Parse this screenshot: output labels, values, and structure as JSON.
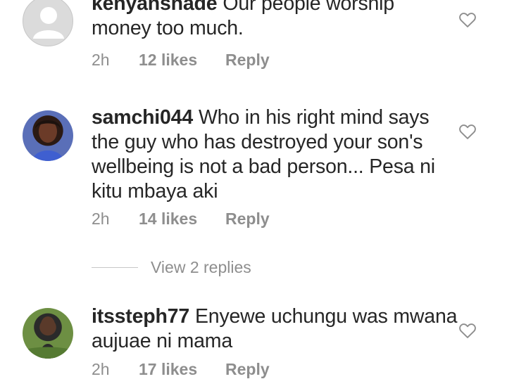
{
  "comments": [
    {
      "username": "kenyanshade",
      "text": "Our people worship money too much.",
      "time": "2h",
      "likes": "12 likes",
      "reply_label": "Reply",
      "avatar": "default-avatar-icon"
    },
    {
      "username": "samchi044",
      "text": "Who in his right mind says the guy who has destroyed your son's wellbeing is not a bad person... Pesa ni kitu mbaya aki",
      "time": "2h",
      "likes": "14 likes",
      "reply_label": "Reply",
      "avatar": "profile-photo"
    },
    {
      "username": "itssteph77",
      "text": "Enyewe uchungu was mwana aujuae ni mama",
      "time": "2h",
      "likes": "17 likes",
      "reply_label": "Reply",
      "avatar": "profile-photo"
    }
  ],
  "view_replies": {
    "label": "View 2 replies"
  },
  "icons": {
    "like": "heart-outline-icon"
  },
  "colors": {
    "text": "#262626",
    "secondary": "#8e8e8e",
    "divider": "#c7c7c7"
  }
}
